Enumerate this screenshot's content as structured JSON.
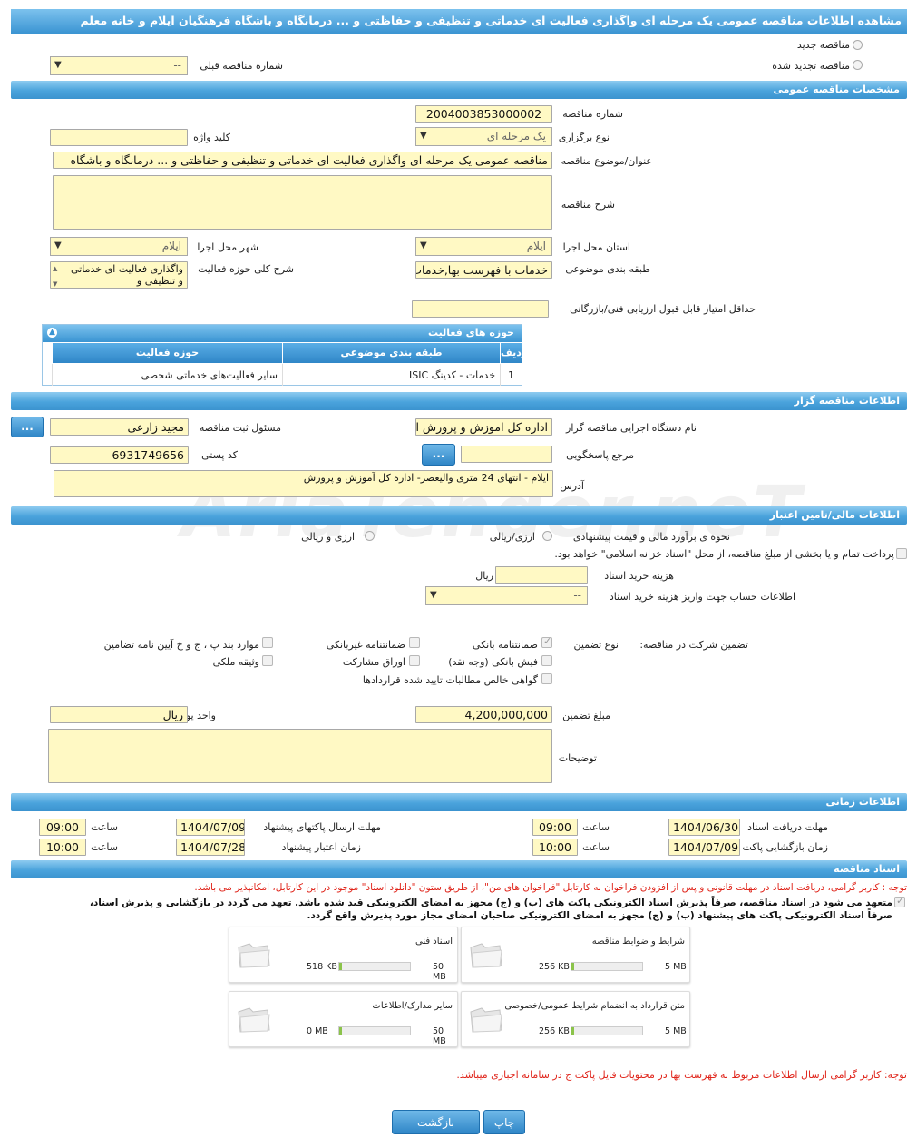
{
  "header": {
    "title": "مشاهده اطلاعات مناقصه عمومی یک مرحله ای واگذاری فعالیت ای خدماتی و تنظیفی و حفاظتی و ... درمانگاه و باشگاه فرهنگیان ایلام و خانه معلم"
  },
  "top": {
    "new_label": "مناقصه جدید",
    "renewed_label": "مناقصه تجدید شده",
    "prev_number_label": "شماره مناقصه قبلی",
    "prev_number_value": "--"
  },
  "general": {
    "bar": "مشخصات مناقصه عمومی",
    "number_label": "شماره مناقصه",
    "number_value": "2004003853000002",
    "type_label": "نوع برگزاری",
    "type_value": "یک مرحله ای",
    "keyword_label": "کلید واژه",
    "subject_label": "عنوان/موضوع مناقصه",
    "subject_value": "مناقصه عمومی یک مرحله ای واگذاری فعالیت ای خدماتی و تنظیفی و حفاظتی و ... درمانگاه و باشگاه",
    "desc_label": "شرح مناقصه",
    "province_label": "استان محل اجرا",
    "province_value": "ایلام",
    "city_label": "شهر محل اجرا",
    "city_value": "ایلام",
    "category_label": "طبقه بندی موضوعی",
    "category_value": "خدمات با فهرست بها,خدمات",
    "activity_label": "شرح کلی حوزه فعالیت",
    "activity_value": "واگذاری فعالیت ای خدماتی و تنظیفی و",
    "score_label": "حداقل امتیاز قابل قبول ارزیابی فنی/بازرگانی"
  },
  "activity_table": {
    "title": "حوزه های فعالیت",
    "col_row": "ردیف",
    "col_cat": "طبقه بندی موضوعی",
    "col_field": "حوزه فعالیت",
    "rows": [
      {
        "row": "1",
        "cat": "خدمات - کدینگ ISIC",
        "field": "سایر فعالیت‌های خدماتی شخصی"
      }
    ]
  },
  "organizer": {
    "bar": "اطلاعات مناقصه گزار",
    "org_label": "نام دستگاه اجرایی مناقصه گزار",
    "org_value": "اداره کل اموزش و پرورش اس",
    "officer_label": "مسئول ثبت مناقصه",
    "officer_value": "مجید زارعی",
    "ref_label": "مرجع پاسخگویی",
    "postal_label": "کد پستی",
    "postal_value": "6931749656",
    "address_label": "آدرس",
    "address_value": "ایلام - انتهای 24 متری والیعصر- اداره کل آموزش و پرورش",
    "btn": "..."
  },
  "finance": {
    "bar": "اطلاعات مالی/تامین اعتبار",
    "estimate_label": "نحوه ی برآورد مالی و قیمت پیشنهادی",
    "opt1": "ارزی/ریالی",
    "opt2": "ارزی و ریالی",
    "treasury_text": "پرداخت تمام و یا بخشی از مبلغ مناقصه، از محل \"اسناد خزانه اسلامی\" خواهد بود.",
    "doc_cost_label": "هزینه خرید اسناد",
    "doc_cost_unit": "ریال",
    "account_label": "اطلاعات حساب جهت واریز هزینه خرید اسناد",
    "account_value": "--"
  },
  "guarantee": {
    "label": "تضمین شرکت در مناقصه:",
    "type_label": "نوع تضمین",
    "opts": [
      "ضمانتنامه بانکی",
      "ضمانتنامه غیربانکی",
      "موارد بند پ ، ج و خ آیین نامه تضامین",
      "فیش بانکی (وجه نقد)",
      "اوراق مشارکت",
      "وثیقه ملکی",
      "گواهی خالص مطالبات تایید شده قراردادها"
    ],
    "amount_label": "مبلغ تضمین",
    "amount_value": "4,200,000,000",
    "currency_label": "واحد پول",
    "currency_value": "ریال",
    "notes_label": "توضیحات"
  },
  "timing": {
    "bar": "اطلاعات زمانی",
    "receive_label": "مهلت دریافت اسناد",
    "receive_date": "1404/06/30",
    "receive_time": "09:00",
    "send_label": "مهلت ارسال پاکتهای پیشنهاد",
    "send_date": "1404/07/09",
    "send_time": "09:00",
    "open_label": "زمان بازگشایی پاکت ها",
    "open_date": "1404/07/09",
    "open_time": "10:00",
    "valid_label": "زمان اعتبار پیشنهاد",
    "valid_date": "1404/07/28",
    "valid_time": "10:00",
    "time_label": "ساعت"
  },
  "docs": {
    "bar": "اسناد مناقصه",
    "note1": "توجه : کاربر گرامی، دریافت اسناد در مهلت قانونی و پس از افزودن فراخوان به کارتابل \"فراخوان های من\"، از طریق ستون \"دانلود اسناد\" موجود در این کارتابل، امکانپذیر می باشد.",
    "commit1": "متعهد می شود در اسناد مناقصه، صرفاً پذیرش اسناد الکترونیکی پاکت های (ب) و (ج) مجهز به امضای الکترونیکی قید شده باشد. تعهد می گردد در بازگشایی و پذیرش اسناد،",
    "commit2": "صرفاً اسناد الکترونیکی پاکت های پیشنهاد (ب) و (ج) مجهز به امضای الکترونیکی صاحبان امضای مجاز مورد پذیرش واقع گردد.",
    "files": [
      {
        "title": "شرایط و ضوابط مناقصه",
        "size": "256 KB",
        "max": "5 MB"
      },
      {
        "title": "اسناد فنی",
        "size": "518 KB",
        "max": "50 MB"
      },
      {
        "title": "متن قرارداد به انضمام شرایط عمومی/خصوصی",
        "size": "256 KB",
        "max": "5 MB"
      },
      {
        "title": "سایر مدارک/اطلاعات",
        "size": "0 MB",
        "max": "50 MB"
      }
    ],
    "note2": "توجه: کاربر گرامی ارسال اطلاعات مربوط به فهرست بها در محتویات فایل پاکت ج در سامانه اجباری میباشد."
  },
  "buttons": {
    "print": "چاپ",
    "back": "بازگشت"
  },
  "watermark": "AriaTender.neT"
}
